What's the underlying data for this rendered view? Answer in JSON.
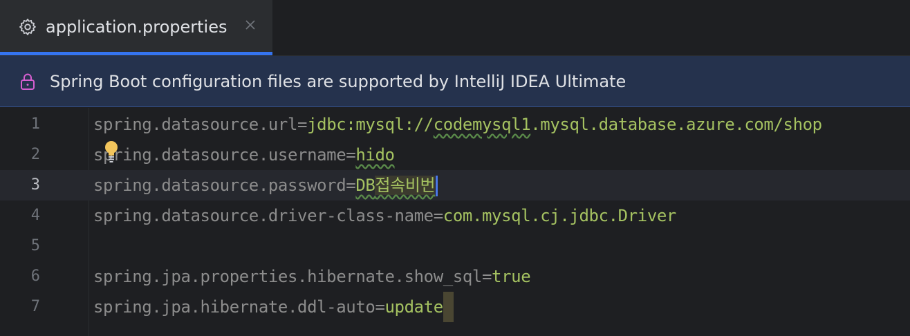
{
  "tab": {
    "title": "application.properties",
    "icon": "gear-icon",
    "close_icon": "close-icon"
  },
  "banner": {
    "text": "Spring Boot configuration files are supported by IntelliJ IDEA Ultimate",
    "icon": "lock-icon"
  },
  "editor": {
    "current_line": 3,
    "lines": [
      {
        "number": "1",
        "key": "spring.datasource.url",
        "eq": "=",
        "value": "jdbc:mysql://codemysql1.mysql.database.azure.com/shop"
      },
      {
        "number": "2",
        "key": "spring.datasource.username",
        "eq": "=",
        "value": "hido"
      },
      {
        "number": "3",
        "key": "spring.datasource.password",
        "eq": "=",
        "value": "DB접속비번"
      },
      {
        "number": "4",
        "key": "spring.datasource.driver-class-name",
        "eq": "=",
        "value": "com.mysql.cj.jdbc.Driver"
      },
      {
        "number": "5",
        "key": "",
        "eq": "",
        "value": ""
      },
      {
        "number": "6",
        "key": "spring.jpa.properties.hibernate.show_sql",
        "eq": "=",
        "value": "true"
      },
      {
        "number": "7",
        "key": "spring.jpa.hibernate.ddl-auto",
        "eq": "=",
        "value": "update"
      }
    ],
    "value_parts": {
      "l1_a": "jdbc:mysql://",
      "l1_b": "codemysql1",
      "l1_c": ".mysql.database.azure.com/shop",
      "l3_a": "DB",
      "l3_b": "접속비번"
    },
    "intention_icon": "lightbulb-icon"
  },
  "colors": {
    "accent": "#3574f0",
    "banner_bg": "#25324d",
    "value": "#a5c261",
    "key": "#8c8c8c"
  }
}
